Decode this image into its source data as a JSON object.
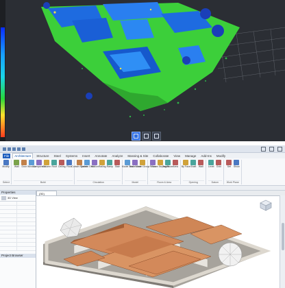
{
  "viewer": {
    "scale_colors": [
      "#0a2cff",
      "#18a0ff",
      "#19d6e8",
      "#27d83a",
      "#ffe12a",
      "#ff3b1e"
    ],
    "tools": [
      {
        "name": "grid-view-icon",
        "active": true
      },
      {
        "name": "box-select-icon",
        "active": false
      },
      {
        "name": "camera-icon",
        "active": false
      }
    ]
  },
  "revit": {
    "title": "",
    "tabs": [
      "File",
      "Architecture",
      "Structure",
      "Steel",
      "Systems",
      "Insert",
      "Annotate",
      "Analyze",
      "Massing & Site",
      "Collaborate",
      "View",
      "Manage",
      "Add-Ins",
      "Modify"
    ],
    "active_tab": "Architecture",
    "ribbon_groups": [
      {
        "label": "Select",
        "buttons": [
          "Modify"
        ]
      },
      {
        "label": "Build",
        "buttons": [
          "Wall",
          "Door",
          "Window",
          "Component",
          "Column",
          "Roof",
          "Ceiling",
          "Floor"
        ]
      },
      {
        "label": "Circulation",
        "buttons": [
          "Curtain System",
          "Curtain Grid",
          "Mullion",
          "Railing",
          "Ramp",
          "Stair"
        ]
      },
      {
        "label": "Model",
        "buttons": [
          "Model Text",
          "Model Line",
          "Model Group"
        ]
      },
      {
        "label": "Room & Area",
        "buttons": [
          "Room",
          "Room Separator",
          "Tag Room",
          "Area"
        ]
      },
      {
        "label": "Opening",
        "buttons": [
          "By Face",
          "Shaft",
          "Wall"
        ]
      },
      {
        "label": "Datum",
        "buttons": [
          "Level",
          "Grid"
        ]
      },
      {
        "label": "Work Plane",
        "buttons": [
          "Set",
          "Show"
        ]
      }
    ],
    "options_bar": "",
    "properties": {
      "header": "Properties",
      "type": "3D View",
      "rows": [
        {
          "k": "",
          "v": ""
        },
        {
          "k": "",
          "v": ""
        },
        {
          "k": "",
          "v": ""
        },
        {
          "k": "",
          "v": ""
        },
        {
          "k": "",
          "v": ""
        },
        {
          "k": "",
          "v": ""
        },
        {
          "k": "",
          "v": ""
        },
        {
          "k": "",
          "v": ""
        },
        {
          "k": "",
          "v": ""
        },
        {
          "k": "",
          "v": ""
        },
        {
          "k": "",
          "v": ""
        },
        {
          "k": "",
          "v": ""
        }
      ],
      "browser_header": "Project Browser",
      "browser_items": [
        "",
        "",
        "",
        "",
        "",
        "",
        ""
      ]
    },
    "view_tab": "{3D}",
    "colors": {
      "roof": "#d3895a",
      "roof_dark": "#a35f36",
      "wall": "#e7e4de",
      "wall_shade": "#bdb8af",
      "ground": "#9e9a94",
      "accent": "#1f5fbf"
    }
  }
}
